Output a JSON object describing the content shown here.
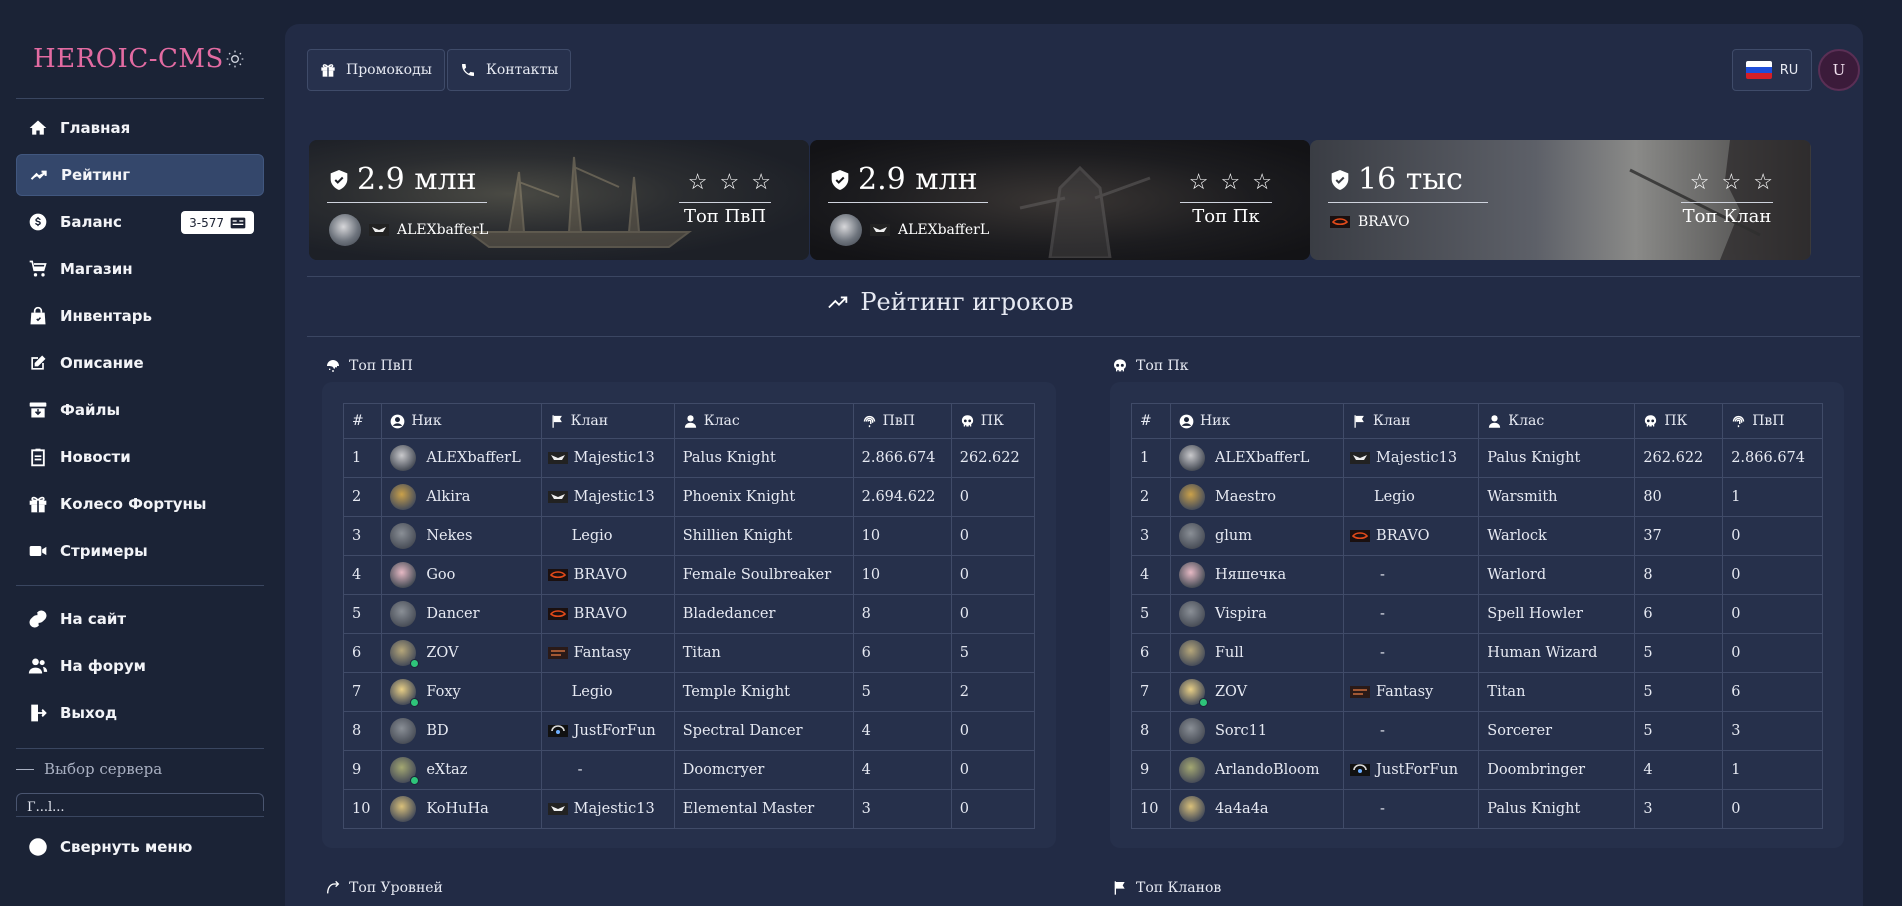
{
  "brand": {
    "title": "HEROIC-CMS"
  },
  "sidebar": {
    "items": [
      {
        "label": "Главная",
        "icon": "home-icon"
      },
      {
        "label": "Рейтинг",
        "icon": "trending-icon",
        "active": true
      },
      {
        "label": "Баланс",
        "icon": "dollar-icon",
        "badge": "3-577"
      },
      {
        "label": "Магазин",
        "icon": "cart-icon"
      },
      {
        "label": "Инвентарь",
        "icon": "bag-icon"
      },
      {
        "label": "Описание",
        "icon": "edit-icon"
      },
      {
        "label": "Файлы",
        "icon": "archive-icon"
      },
      {
        "label": "Новости",
        "icon": "news-icon"
      },
      {
        "label": "Колесо Фортуны",
        "icon": "gift-icon"
      },
      {
        "label": "Стримеры",
        "icon": "video-icon"
      }
    ],
    "links": [
      {
        "label": "На сайт",
        "icon": "link-icon"
      },
      {
        "label": "На форум",
        "icon": "users-icon"
      },
      {
        "label": "Выход",
        "icon": "logout-icon"
      }
    ],
    "server_label": "Выбор сервера",
    "server_value": "Г...l...",
    "collapse_label": "Свернуть меню"
  },
  "topbar": {
    "promo_label": "Промокоды",
    "contacts_label": "Контакты",
    "lang": "RU",
    "user_initial": "U"
  },
  "hero": [
    {
      "value": "2.9 млн",
      "name": "ALEXbafferL",
      "label": "Топ ПвП",
      "stars": 3
    },
    {
      "value": "2.9 млн",
      "name": "ALEXbafferL",
      "label": "Топ Пк",
      "stars": 3
    },
    {
      "value": "16 тыс",
      "name": "BRAVO",
      "label": "Топ Клан",
      "stars": 3
    }
  ],
  "section_title": "Рейтинг игроков",
  "pvp": {
    "title": "Топ ПвП",
    "headers": [
      "#",
      "Ник",
      "Клан",
      "Клас",
      "ПвП",
      "ПК"
    ],
    "rows": [
      {
        "n": "1",
        "nick": "ALEXbafferL",
        "clan": "Majestic13",
        "cls": "Palus Knight",
        "a": "2.866.674",
        "b": "262.622"
      },
      {
        "n": "2",
        "nick": "Alkira",
        "clan": "Majestic13",
        "cls": "Phoenix Knight",
        "a": "2.694.622",
        "b": "0"
      },
      {
        "n": "3",
        "nick": "Nekes",
        "clan": "Legio",
        "cls": "Shillien Knight",
        "a": "10",
        "b": "0"
      },
      {
        "n": "4",
        "nick": "Goo",
        "clan": "BRAVO",
        "cls": "Female Soulbreaker",
        "a": "10",
        "b": "0"
      },
      {
        "n": "5",
        "nick": "Dancer",
        "clan": "BRAVO",
        "cls": "Bladedancer",
        "a": "8",
        "b": "0"
      },
      {
        "n": "6",
        "nick": "ZOV",
        "clan": "Fantasy",
        "cls": "Titan",
        "a": "6",
        "b": "5"
      },
      {
        "n": "7",
        "nick": "Foxy",
        "clan": "Legio",
        "cls": "Temple Knight",
        "a": "5",
        "b": "2"
      },
      {
        "n": "8",
        "nick": "BD",
        "clan": "JustForFun",
        "cls": "Spectral Dancer",
        "a": "4",
        "b": "0"
      },
      {
        "n": "9",
        "nick": "eXtaz",
        "clan": "-",
        "cls": "Doomcryer",
        "a": "4",
        "b": "0"
      },
      {
        "n": "10",
        "nick": "KoHuHa",
        "clan": "Majestic13",
        "cls": "Elemental Master",
        "a": "3",
        "b": "0"
      }
    ]
  },
  "pk": {
    "title": "Топ Пк",
    "headers": [
      "#",
      "Ник",
      "Клан",
      "Клас",
      "ПК",
      "ПвП"
    ],
    "rows": [
      {
        "n": "1",
        "nick": "ALEXbafferL",
        "clan": "Majestic13",
        "cls": "Palus Knight",
        "a": "262.622",
        "b": "2.866.674"
      },
      {
        "n": "2",
        "nick": "Maestro",
        "clan": "Legio",
        "cls": "Warsmith",
        "a": "80",
        "b": "1"
      },
      {
        "n": "3",
        "nick": "glum",
        "clan": "BRAVO",
        "cls": "Warlock",
        "a": "37",
        "b": "0"
      },
      {
        "n": "4",
        "nick": "Няшечка",
        "clan": "-",
        "cls": "Warlord",
        "a": "8",
        "b": "0"
      },
      {
        "n": "5",
        "nick": "Vispira",
        "clan": "-",
        "cls": "Spell Howler",
        "a": "6",
        "b": "0"
      },
      {
        "n": "6",
        "nick": "Full",
        "clan": "-",
        "cls": "Human Wizard",
        "a": "5",
        "b": "0"
      },
      {
        "n": "7",
        "nick": "ZOV",
        "clan": "Fantasy",
        "cls": "Titan",
        "a": "5",
        "b": "6"
      },
      {
        "n": "8",
        "nick": "Sorc11",
        "clan": "-",
        "cls": "Sorcerer",
        "a": "5",
        "b": "3"
      },
      {
        "n": "9",
        "nick": "ArlandoBloom",
        "clan": "JustForFun",
        "cls": "Doombringer",
        "a": "4",
        "b": "1"
      },
      {
        "n": "10",
        "nick": "4a4a4a",
        "clan": "-",
        "cls": "Palus Knight",
        "a": "3",
        "b": "0"
      }
    ]
  },
  "bottom": {
    "levels_title": "Топ Уровней",
    "clans_title": "Топ Кланов"
  },
  "colors": {
    "accent": "#e36ba2",
    "bg": "#1a2236",
    "panel": "#26304b",
    "online": "#2ec47a"
  }
}
